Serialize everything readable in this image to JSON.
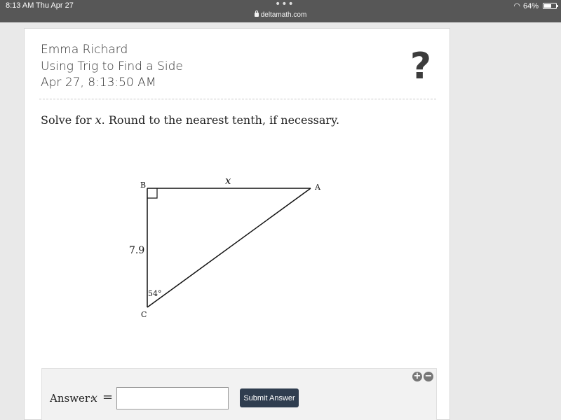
{
  "status_bar": {
    "time": "8:13 AM",
    "date": "Thu Apr 27",
    "dots": "•••",
    "url": "deltamath.com",
    "battery": "64%",
    "battery_level": 0.64
  },
  "header": {
    "student_name": "Emma Richard",
    "assignment": "Using Trig to Find a Side",
    "timestamp": "Apr 27, 8:13:50 AM",
    "help_symbol": "?"
  },
  "problem": {
    "prefix": "Solve for",
    "variable": "x",
    "suffix": ". Round to the nearest tenth, if necessary."
  },
  "diagram": {
    "vertex_a": "A",
    "vertex_b": "B",
    "vertex_c": "C",
    "side_bc": "7.9",
    "side_ab": "x",
    "angle_c": "54°"
  },
  "answer": {
    "label": "Answer:",
    "variable": "x",
    "equals": "=",
    "value": "",
    "submit_label": "Submit Answer",
    "zoom_in": "+",
    "zoom_out": "−"
  }
}
